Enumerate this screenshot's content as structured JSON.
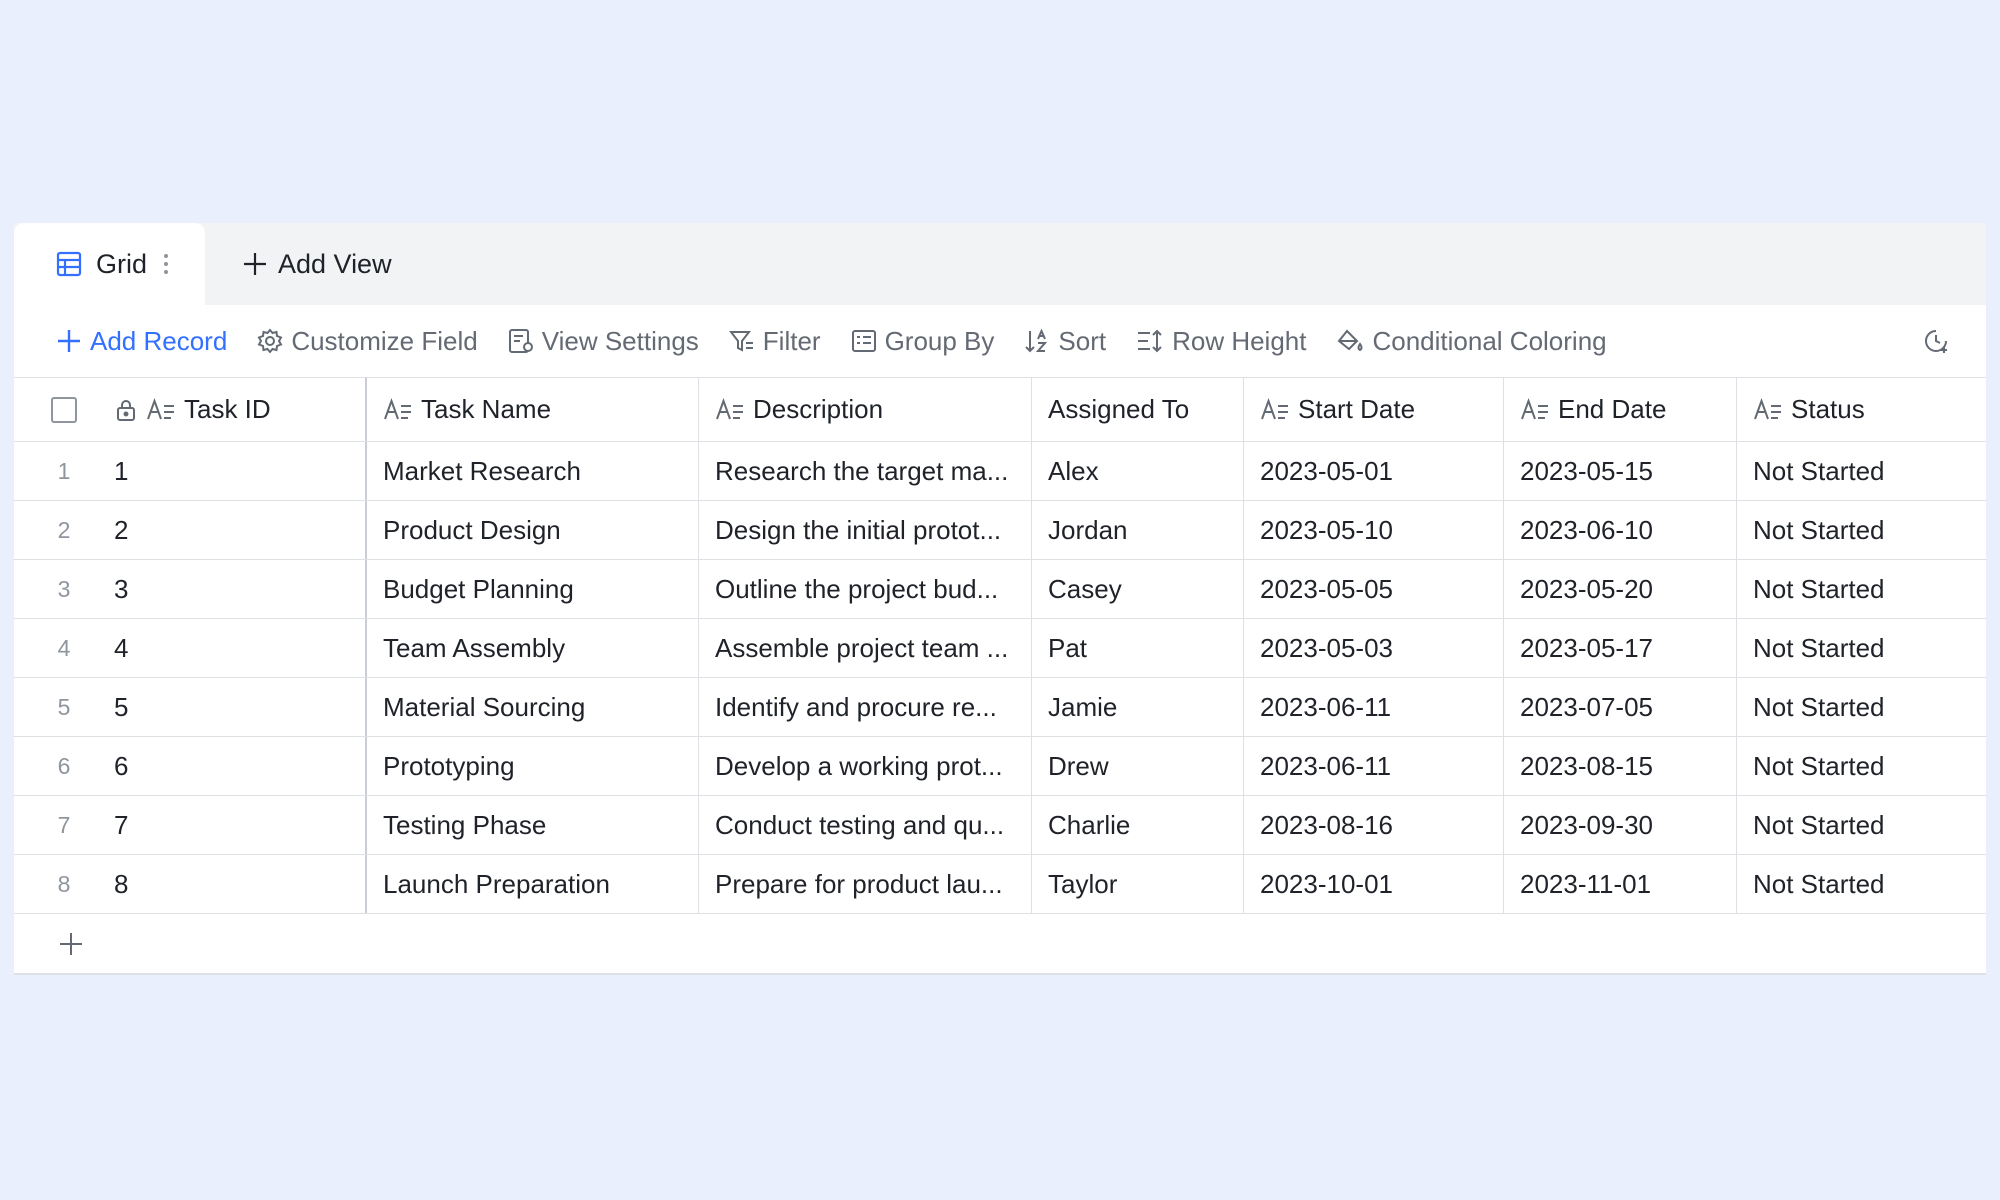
{
  "tabs": {
    "active_label": "Grid",
    "add_view_label": "Add View"
  },
  "toolbar": {
    "add_record": "Add Record",
    "customize_field": "Customize Field",
    "view_settings": "View Settings",
    "filter": "Filter",
    "group_by": "Group By",
    "sort": "Sort",
    "row_height": "Row Height",
    "conditional_coloring": "Conditional Coloring"
  },
  "colors": {
    "accent": "#3370ff",
    "background": "#e9effd",
    "toolbar_text": "#646a73"
  },
  "table": {
    "headers": {
      "task_id": "Task ID",
      "task_name": "Task Name",
      "description": "Description",
      "assigned_to": "Assigned To",
      "start_date": "Start Date",
      "end_date": "End Date",
      "status": "Status"
    },
    "rows": [
      {
        "index": "1",
        "task_id": "1",
        "task_name": "Market Research",
        "description": "Research the target ma...",
        "assigned_to": "Alex",
        "start_date": "2023-05-01",
        "end_date": "2023-05-15",
        "status": "Not Started"
      },
      {
        "index": "2",
        "task_id": "2",
        "task_name": "Product Design",
        "description": "Design the initial protot...",
        "assigned_to": "Jordan",
        "start_date": "2023-05-10",
        "end_date": "2023-06-10",
        "status": "Not Started"
      },
      {
        "index": "3",
        "task_id": "3",
        "task_name": "Budget Planning",
        "description": "Outline the project bud...",
        "assigned_to": "Casey",
        "start_date": "2023-05-05",
        "end_date": "2023-05-20",
        "status": "Not Started"
      },
      {
        "index": "4",
        "task_id": "4",
        "task_name": "Team Assembly",
        "description": "Assemble project team ...",
        "assigned_to": "Pat",
        "start_date": "2023-05-03",
        "end_date": "2023-05-17",
        "status": "Not Started"
      },
      {
        "index": "5",
        "task_id": "5",
        "task_name": "Material Sourcing",
        "description": "Identify and procure re...",
        "assigned_to": "Jamie",
        "start_date": "2023-06-11",
        "end_date": "2023-07-05",
        "status": "Not Started"
      },
      {
        "index": "6",
        "task_id": "6",
        "task_name": "Prototyping",
        "description": "Develop a working prot...",
        "assigned_to": "Drew",
        "start_date": "2023-06-11",
        "end_date": "2023-08-15",
        "status": "Not Started"
      },
      {
        "index": "7",
        "task_id": "7",
        "task_name": "Testing Phase",
        "description": "Conduct testing and qu...",
        "assigned_to": "Charlie",
        "start_date": "2023-08-16",
        "end_date": "2023-09-30",
        "status": "Not Started"
      },
      {
        "index": "8",
        "task_id": "8",
        "task_name": "Launch Preparation",
        "description": "Prepare for product lau...",
        "assigned_to": "Taylor",
        "start_date": "2023-10-01",
        "end_date": "2023-11-01",
        "status": "Not Started"
      }
    ]
  }
}
